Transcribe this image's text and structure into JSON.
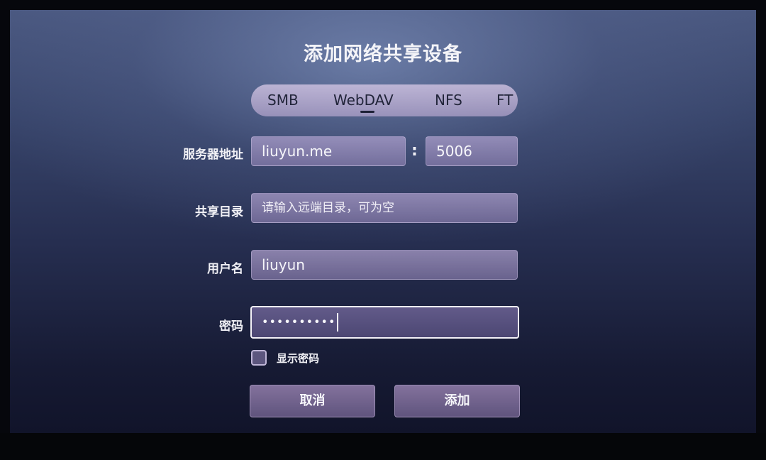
{
  "dialog": {
    "title": "添加网络共享设备"
  },
  "tabs": [
    {
      "label": "SMB",
      "selected": false
    },
    {
      "label": "WebDAV",
      "selected": true
    },
    {
      "label": "NFS",
      "selected": false
    },
    {
      "label": "FT",
      "selected": false
    }
  ],
  "server": {
    "label": "服务器地址",
    "host": "liuyun.me",
    "separator": ":",
    "port": "5006"
  },
  "share_dir": {
    "label": "共享目录",
    "value": "",
    "placeholder": "请输入远端目录，可为空"
  },
  "username": {
    "label": "用户名",
    "value": "liuyun"
  },
  "password": {
    "label": "密码",
    "masked_value": "••••••••••"
  },
  "show_password": {
    "label": "显示密码",
    "checked": false
  },
  "buttons": {
    "cancel": "取消",
    "add": "添加"
  },
  "colors": {
    "accent_field": "#a898c8",
    "active_border": "#f4f2f8",
    "background_top": "#4a5880",
    "background_bottom": "#11142a"
  }
}
